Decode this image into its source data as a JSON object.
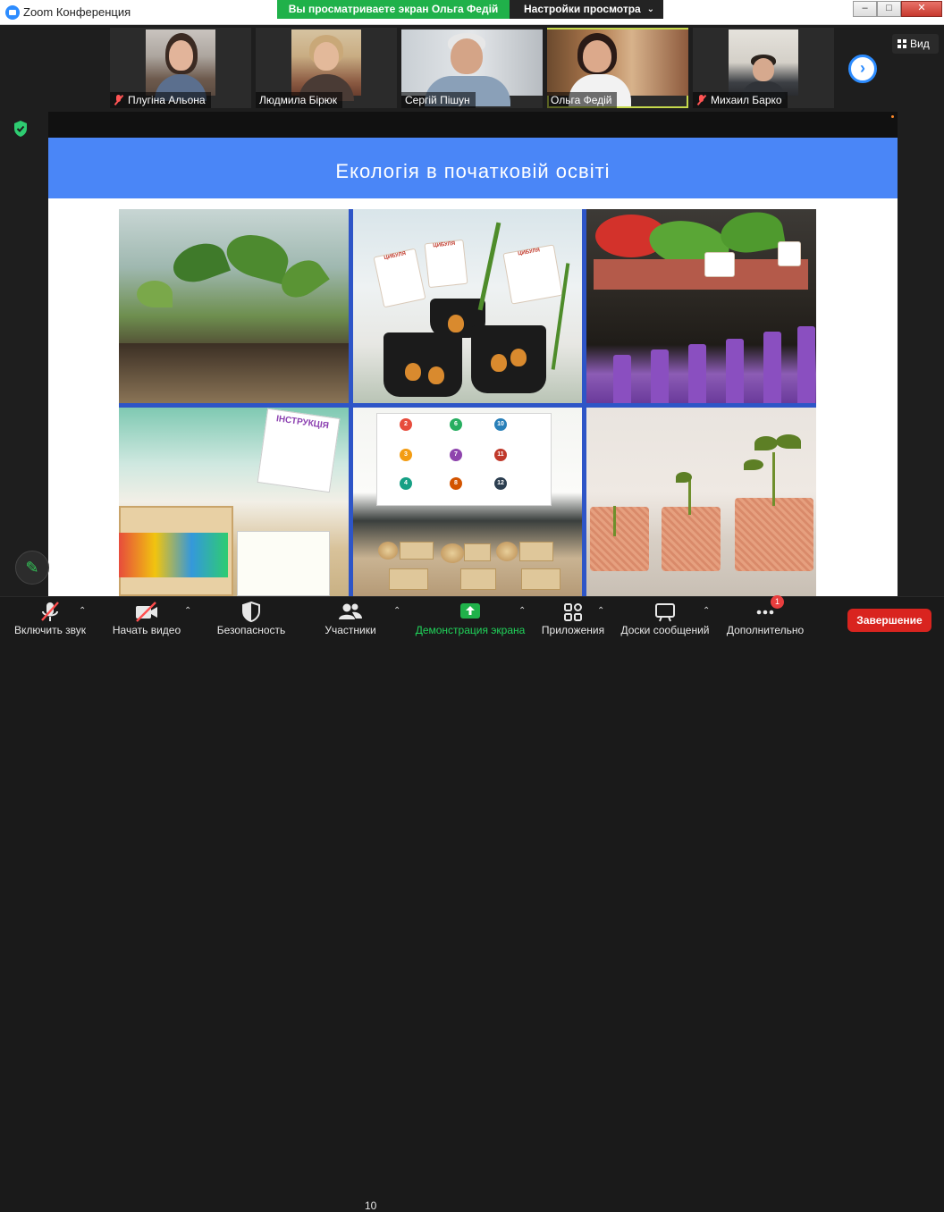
{
  "window": {
    "title": "Zoom Конференция",
    "share_banner": "Вы просматриваете экран Ольга Федій",
    "view_settings": "Настройки просмотра",
    "min_symbol": "–",
    "max_symbol": "□",
    "close_symbol": "✕"
  },
  "gallery": {
    "participants": [
      {
        "name": "Плугіна Альона",
        "muted": true
      },
      {
        "name": "Людмила Бірюк",
        "muted": false
      },
      {
        "name": "Сергій Пішун",
        "muted": false
      },
      {
        "name": "Ольга Федій",
        "muted": false,
        "active_speaker": true
      },
      {
        "name": "Михаил Барко",
        "muted": true
      }
    ],
    "view_label": "Вид",
    "next_symbol": "›"
  },
  "slide": {
    "title": "Екологія в початковій освіті",
    "card_text": "ЦИБУЛЯ",
    "instruction_text": "ІНСТРУКЦІЯ",
    "numbers": [
      "2",
      "6",
      "10",
      "3",
      "7",
      "11",
      "4",
      "8",
      "12"
    ]
  },
  "toolbar": {
    "audio_label": "Включить звук",
    "video_label": "Начать видео",
    "security_label": "Безопасность",
    "participants_label": "Участники",
    "participants_count": "10",
    "share_label": "Демонстрация экрана",
    "apps_label": "Приложения",
    "whiteboard_label": "Доски сообщений",
    "more_label": "Дополнительно",
    "more_badge": "1",
    "end_label": "Завершение"
  },
  "colors": {
    "accent": "#2d8cff",
    "share_green": "#20b14a",
    "slide_header": "#4a86f7",
    "end_red": "#d9241f",
    "active_speaker": "#c6d94c"
  }
}
